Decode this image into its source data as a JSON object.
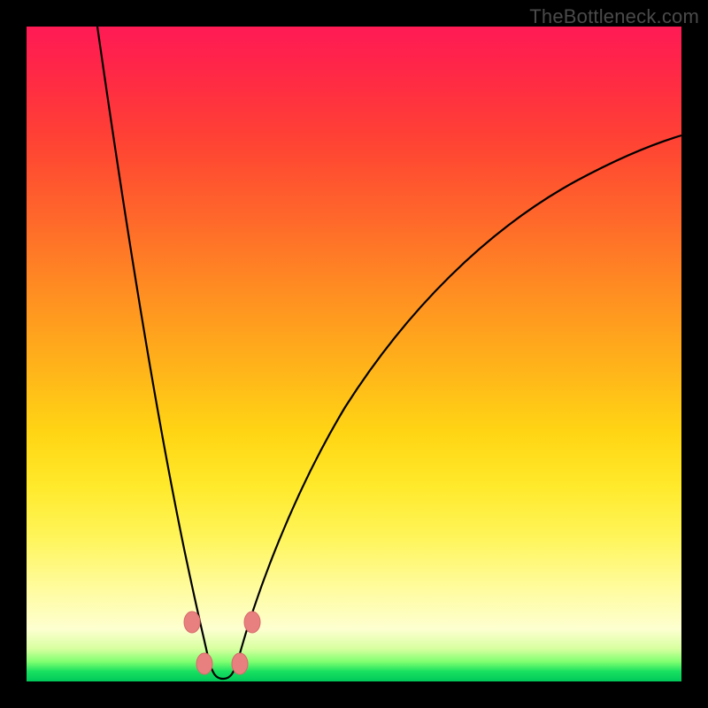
{
  "watermark": "TheBottleneck.com",
  "colors": {
    "frame": "#000000",
    "gradient_top": "#ff1a55",
    "gradient_mid": "#ffd514",
    "gradient_bottom": "#00c85a",
    "curve": "#000000",
    "bead": "#e98080"
  },
  "chart_data": {
    "type": "line",
    "title": "",
    "xlabel": "",
    "ylabel": "",
    "xlim": [
      0,
      100
    ],
    "ylim": [
      0,
      100
    ],
    "series": [
      {
        "name": "left-branch",
        "x": [
          11,
          12,
          13,
          14,
          15,
          16,
          17,
          18,
          19,
          20,
          21,
          22,
          23,
          24,
          25,
          26
        ],
        "y": [
          100,
          90,
          80,
          70,
          60,
          50,
          41,
          33,
          26,
          20,
          15,
          11,
          8,
          5,
          3,
          1
        ]
      },
      {
        "name": "trough",
        "x": [
          26,
          27,
          28,
          29,
          30,
          31,
          32
        ],
        "y": [
          1,
          0.3,
          0.1,
          0.1,
          0.1,
          0.3,
          1
        ]
      },
      {
        "name": "right-branch",
        "x": [
          32,
          34,
          36,
          38,
          40,
          43,
          46,
          50,
          55,
          60,
          66,
          72,
          79,
          86,
          93,
          100
        ],
        "y": [
          1,
          3,
          6,
          9,
          13,
          18,
          24,
          31,
          39,
          47,
          55,
          62,
          69,
          75,
          80,
          84
        ]
      }
    ],
    "markers": [
      {
        "name": "bead-left-upper",
        "x": 24.5,
        "y": 8
      },
      {
        "name": "bead-left-lower",
        "x": 26.0,
        "y": 2
      },
      {
        "name": "bead-right-lower",
        "x": 31.5,
        "y": 2
      },
      {
        "name": "bead-right-upper",
        "x": 33.0,
        "y": 8
      }
    ]
  }
}
